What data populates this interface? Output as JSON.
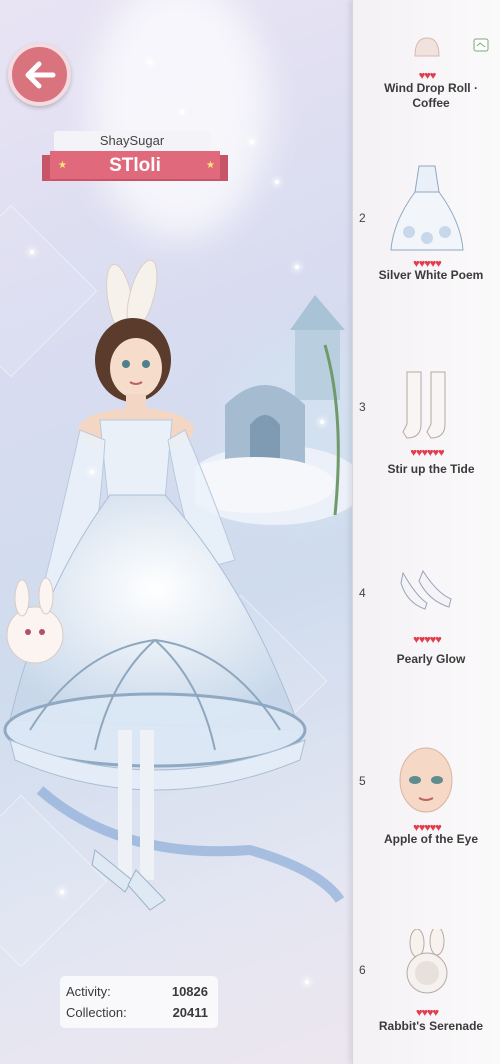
{
  "player": {
    "account": "ShaySugar",
    "name": "STloli"
  },
  "stats": {
    "activity_label": "Activity:",
    "activity_value": "10826",
    "collection_label": "Collection:",
    "collection_value": "20411"
  },
  "icons": {
    "back": "back-arrow-icon",
    "corner_badge": "new-badge-icon"
  },
  "items": [
    {
      "number": "",
      "hearts": "♥♥♥",
      "name": "Wind Drop Roll · Coffee",
      "icon": "hair-bun-icon"
    },
    {
      "number": "2",
      "hearts": "♥♥♥♥♥",
      "name": "Silver White Poem",
      "icon": "dress-icon"
    },
    {
      "number": "3",
      "hearts": "♥♥♥♥♥♥",
      "name": "Stir up the Tide",
      "icon": "stockings-icon"
    },
    {
      "number": "4",
      "hearts": "♥♥♥♥♥",
      "name": "Pearly Glow",
      "icon": "shoes-icon"
    },
    {
      "number": "5",
      "hearts": "♥♥♥♥♥",
      "name": "Apple of the Eye",
      "icon": "face-makeup-icon"
    },
    {
      "number": "6",
      "hearts": "♥♥♥♥",
      "name": "Rabbit's Serenade",
      "icon": "headpiece-icon"
    }
  ],
  "colors": {
    "heart": "#e23d4c",
    "ribbon": "#e06a7c",
    "back_button": "#d9737e"
  }
}
